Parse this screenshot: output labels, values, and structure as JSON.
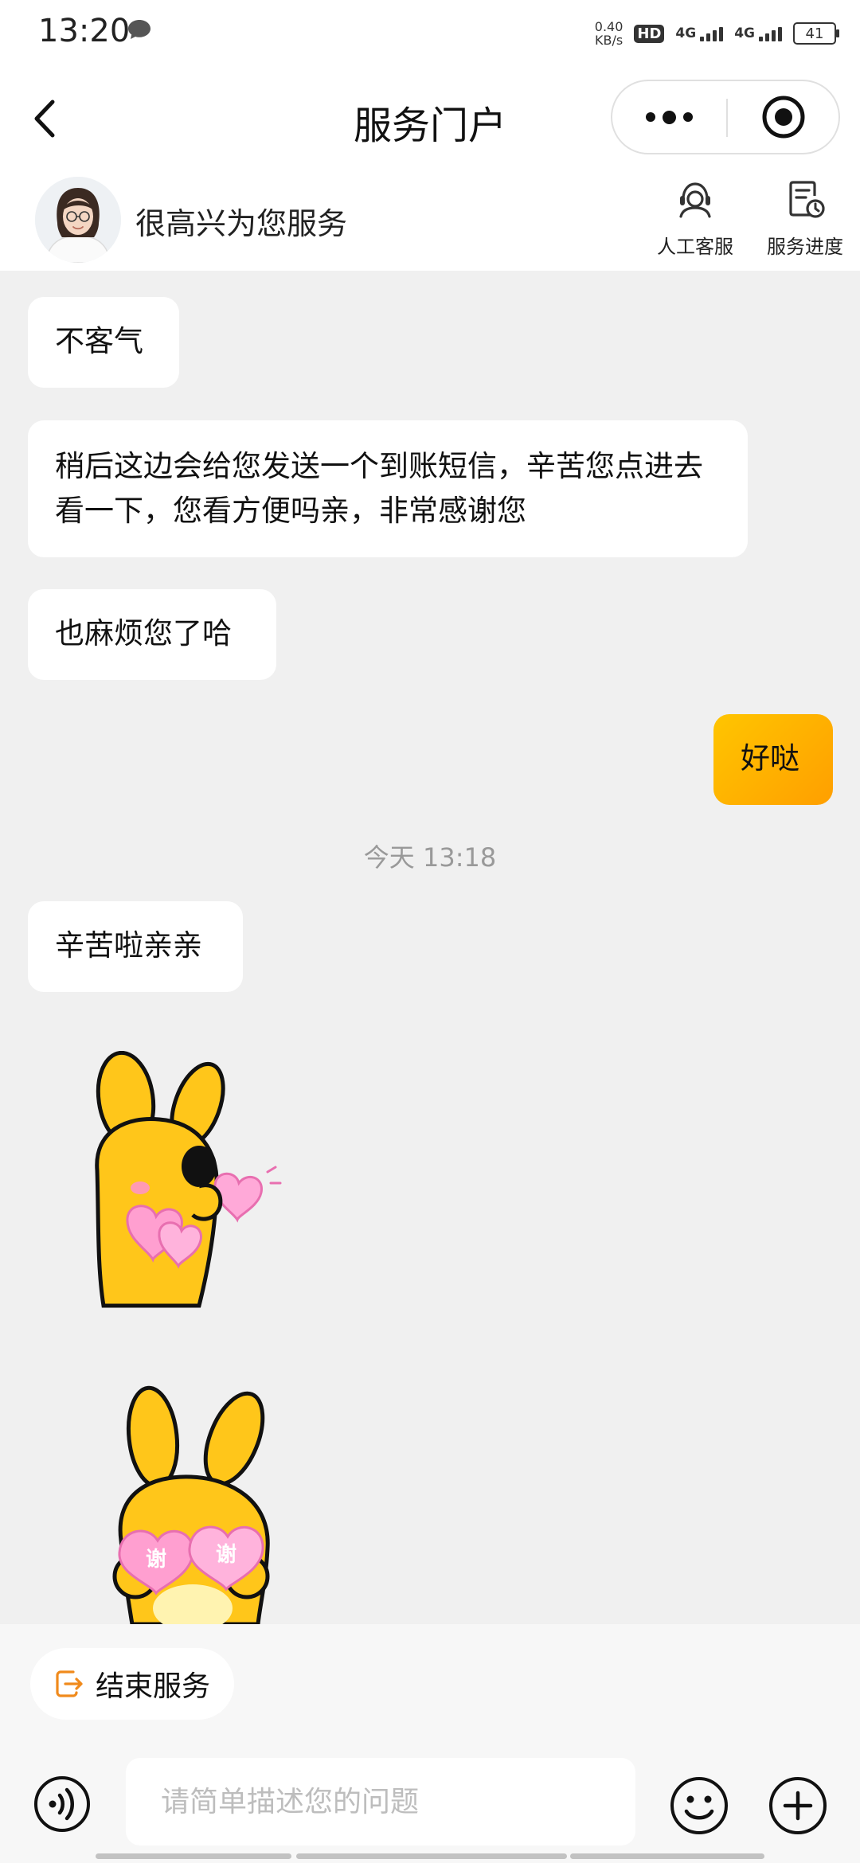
{
  "status_bar": {
    "time": "13:20",
    "net_speed_value": "0.40",
    "net_speed_unit": "KB/s",
    "hd_label": "HD",
    "sim1_label": "4G",
    "sim2_label": "4G",
    "battery": "41"
  },
  "nav": {
    "title": "服务门户",
    "back_icon": "chevron-left-icon",
    "more_icon": "more-dots-icon",
    "close_icon": "target-circle-icon"
  },
  "agent": {
    "greeting": "很高兴为您服务",
    "tools": [
      {
        "label": "人工客服",
        "icon": "headset-agent-icon"
      },
      {
        "label": "服务进度",
        "icon": "progress-document-icon"
      }
    ]
  },
  "messages": [
    {
      "side": "agent",
      "text": "不客气"
    },
    {
      "side": "agent",
      "text": "稍后这边会给您发送一个到账短信，辛苦您点进去看一下，您看方便吗亲，非常感谢您"
    },
    {
      "side": "agent",
      "text": "也麻烦您了哈"
    },
    {
      "side": "user",
      "text": "好哒"
    },
    {
      "side": "agent",
      "text": "辛苦啦亲亲"
    }
  ],
  "timestamp": "今天 13:18",
  "stickers": [
    {
      "name": "rabbit-hearts-sticker",
      "caption": ""
    },
    {
      "name": "rabbit-thanks-sticker",
      "caption": "谢谢"
    }
  ],
  "bottom": {
    "end_service_label": "结束服务",
    "input_placeholder": "请简单描述您的问题",
    "voice_icon": "voice-icon",
    "emoji_icon": "emoji-icon",
    "plus_icon": "plus-icon"
  },
  "colors": {
    "user_bubble": "#ffb300",
    "end_service_icon": "#f08a1c",
    "background": "#f0f0f0"
  }
}
